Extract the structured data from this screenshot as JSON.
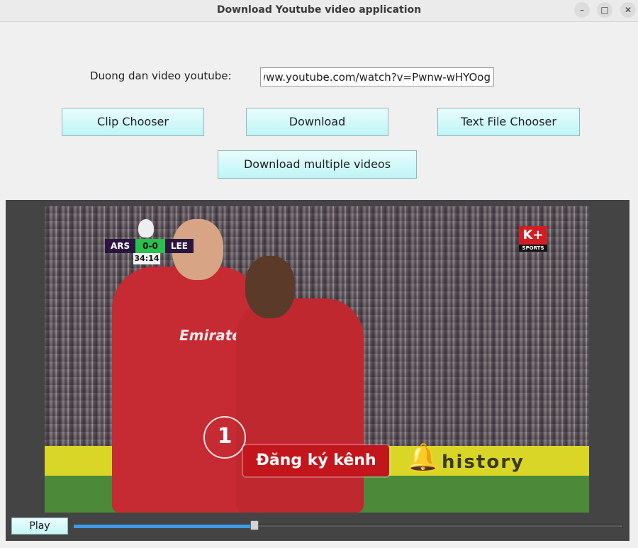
{
  "window": {
    "title": "Download Youtube video application",
    "controls": {
      "minimize": "–",
      "maximize": "□",
      "close": "✕"
    }
  },
  "form": {
    "url_label": "Duong dan video youtube:",
    "url_value": "https://www.youtube.com/watch?v=Pwnw-wHYOog"
  },
  "buttons": {
    "clip_chooser": "Clip Chooser",
    "download": "Download",
    "text_file_chooser": "Text File Chooser",
    "download_multiple": "Download multiple videos"
  },
  "video_frame": {
    "score": {
      "home": "ARS",
      "result": "0-0",
      "away": "LEE",
      "time": "34:14"
    },
    "channel_logo": {
      "main": "K+",
      "sub": "SPORTS"
    },
    "sponsor_text": "Emirates FLY BETTER",
    "board_text": "history",
    "subscribe_label": "Đăng ký kênh",
    "counter": "1"
  },
  "player_controls": {
    "play_label": "Play",
    "progress_fraction": 0.33,
    "accent_color": "#3d9ae8"
  }
}
